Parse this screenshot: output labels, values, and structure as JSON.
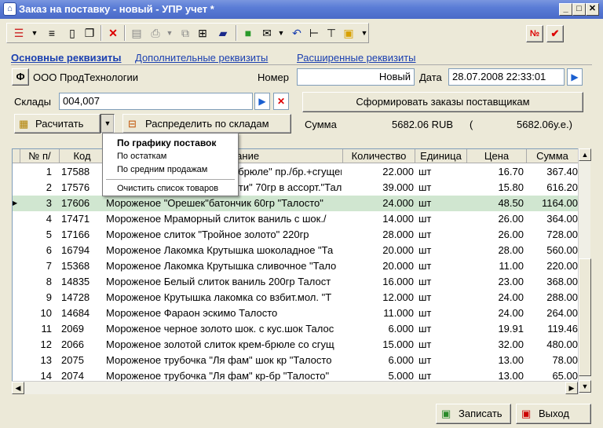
{
  "window": {
    "title": "Заказ на поставку  - новый - УПР учет *",
    "min": "_",
    "max": "□",
    "close": "✕"
  },
  "tabs": [
    "Основные реквизиты",
    "Дополнительные реквизиты",
    "Расширенные реквизиты"
  ],
  "org": {
    "btn": "Ф",
    "name": "ООО ПродТехнологии"
  },
  "number": {
    "label": "Номер",
    "value": "Новый"
  },
  "date": {
    "label": "Дата",
    "value": "28.07.2008 22:33:01"
  },
  "warehouses": {
    "label": "Склады",
    "value": "004,007"
  },
  "form_orders_label": "Сформировать заказы поставщикам",
  "calc_label": "Расчитать",
  "distribute_label": "Распределить по складам",
  "sum": {
    "label": "Сумма",
    "value": "5682.06 RUB",
    "paren_open": "(",
    "value2": "5682.06у.е.)"
  },
  "menu": {
    "items": [
      "По графику поставок",
      "По остаткам",
      "По средним продажам",
      "Очистить список товаров"
    ]
  },
  "columns": [
    "№ п/",
    "Код",
    "Наименование",
    "Количество",
    "Единица",
    "Цена",
    "Сумма"
  ],
  "rows": [
    {
      "n": "1",
      "code": "17588",
      "name": "Мороженое Лакомка \"Крем-брюле\" пр./бр.+сгущенка 7",
      "qty": "22.000",
      "unit": "шт",
      "price": "16.70",
      "sum": "367.40"
    },
    {
      "n": "2",
      "code": "17576",
      "name": "Мороженое Лакомка \"Ассорти\" 70гр в ассорт.\"Тал",
      "qty": "39.000",
      "unit": "шт",
      "price": "15.80",
      "sum": "616.20"
    },
    {
      "n": "3",
      "code": "17606",
      "name": "Мороженое \"Орешек\"батончик  60гр \"Талосто\"",
      "qty": "24.000",
      "unit": "шт",
      "price": "48.50",
      "sum": "1164.00"
    },
    {
      "n": "4",
      "code": "17471",
      "name": "Мороженое Мраморный слиток ваниль с шок./",
      "qty": "14.000",
      "unit": "шт",
      "price": "26.00",
      "sum": "364.00"
    },
    {
      "n": "5",
      "code": "17166",
      "name": "Мороженое слиток \"Тройное золото\" 220гр",
      "qty": "28.000",
      "unit": "шт",
      "price": "26.00",
      "sum": "728.00"
    },
    {
      "n": "6",
      "code": "16794",
      "name": "Мороженое Лакомка Крутышка шоколадное \"Та",
      "qty": "20.000",
      "unit": "шт",
      "price": "28.00",
      "sum": "560.00"
    },
    {
      "n": "7",
      "code": "15368",
      "name": "Мороженое Лакомка Крутышка сливочное \"Тало",
      "qty": "20.000",
      "unit": "шт",
      "price": "11.00",
      "sum": "220.00"
    },
    {
      "n": "8",
      "code": "14835",
      "name": "Мороженое Белый слиток ваниль 200гр Талост",
      "qty": "16.000",
      "unit": "шт",
      "price": "23.00",
      "sum": "368.00"
    },
    {
      "n": "9",
      "code": "14728",
      "name": "Мороженое Крутышка  лакомка со взбит.мол. \"Т",
      "qty": "12.000",
      "unit": "шт",
      "price": "24.00",
      "sum": "288.00"
    },
    {
      "n": "10",
      "code": "14684",
      "name": "Мороженое Фараон  эскимо Талосто",
      "qty": "11.000",
      "unit": "шт",
      "price": "24.00",
      "sum": "264.00"
    },
    {
      "n": "11",
      "code": "2069",
      "name": "Мороженое черное золото шок. с кус.шок Талос",
      "qty": "6.000",
      "unit": "шт",
      "price": "19.91",
      "sum": "119.46"
    },
    {
      "n": "12",
      "code": "2066",
      "name": "Мороженое золотой слиток крем-брюле со сгущ",
      "qty": "15.000",
      "unit": "шт",
      "price": "32.00",
      "sum": "480.00"
    },
    {
      "n": "13",
      "code": "2075",
      "name": "Мороженое трубочка \"Ля фам\" шок кр \"Талосто",
      "qty": "6.000",
      "unit": "шт",
      "price": "13.00",
      "sum": "78.00"
    },
    {
      "n": "14",
      "code": "2074",
      "name": "Мороженое трубочка \"Ля фам\" кр-бр \"Талосто\"",
      "qty": "5.000",
      "unit": "шт",
      "price": "13.00",
      "sum": "65.00"
    }
  ],
  "save_label": "Записать",
  "exit_label": "Выход",
  "colors": {
    "accent": "#1a3fb0",
    "selected_row": "#d0e6d0",
    "title_bar": "#5a7cd6"
  }
}
